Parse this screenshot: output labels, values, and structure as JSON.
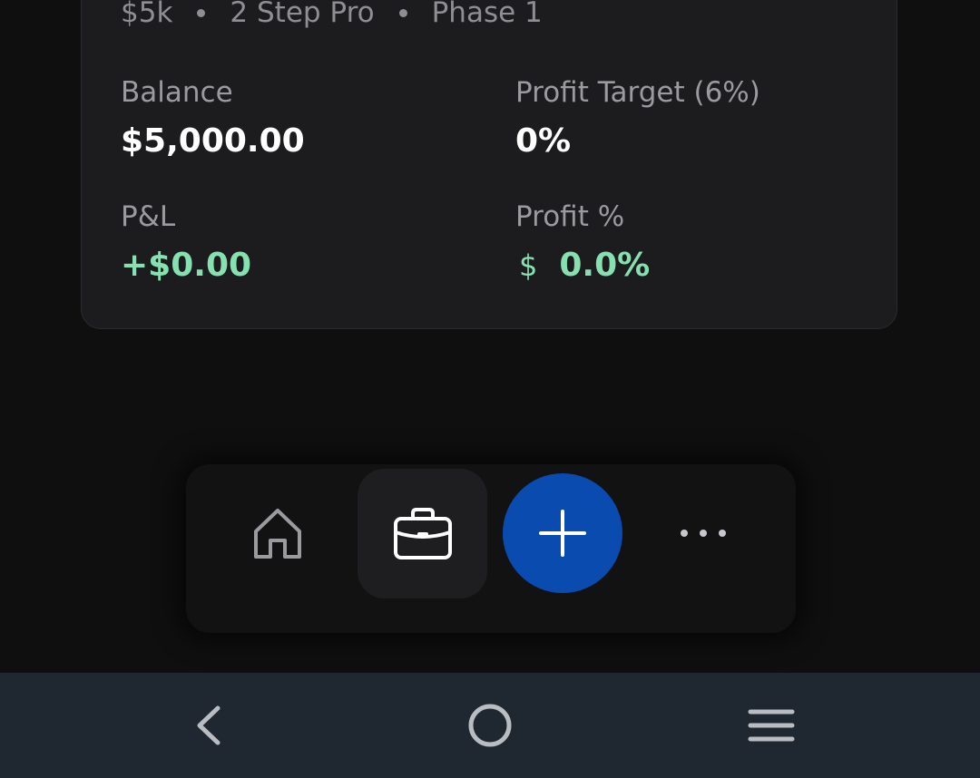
{
  "account_card": {
    "size": "$5k",
    "program": "2 Step Pro",
    "phase": "Phase 1",
    "balance_label": "Balance",
    "balance_value": "$5,000.00",
    "target_label": "Profit Target (6%)",
    "target_value": "0%",
    "pnl_label": "P&L",
    "pnl_value": "+$0.00",
    "profit_pct_label": "Profit %",
    "profit_pct_icon": "$",
    "profit_pct_value": "0.0%"
  },
  "bottom_nav": {
    "items": [
      "home-icon",
      "briefcase-icon",
      "plus-icon",
      "more-icon"
    ],
    "active": "briefcase-icon",
    "fab_color": "#0a4bb0"
  },
  "system_nav": {
    "buttons": [
      "back-icon",
      "home-circle-icon",
      "recent-apps-icon"
    ]
  },
  "colors": {
    "positive": "#86e0b0",
    "card_bg": "#1c1c1e",
    "page_bg": "#0f0f10"
  }
}
